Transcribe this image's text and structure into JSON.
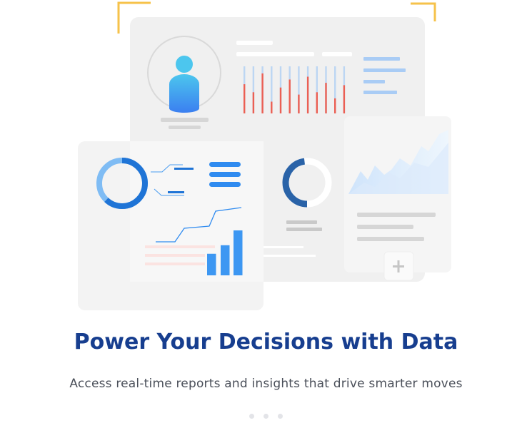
{
  "onboarding": {
    "title": "Power Your Decisions with Data",
    "subtitle": "Access real-time reports and insights that drive smarter moves",
    "pagination": {
      "total_pages": 3
    }
  },
  "illustration": {
    "icons": [
      "user-avatar-icon",
      "donut-chart-icon",
      "bar-chart-icon",
      "line-chart-icon",
      "area-chart-icon",
      "add-icon",
      "menu-icon"
    ],
    "colors": {
      "accent": "#2f8bf0",
      "title": "#173e8f",
      "bars_red": "#ec5f53",
      "corner_marks": "#f6c24a"
    },
    "equalizer_levels": [
      0.62,
      0.45,
      0.85,
      0.25,
      0.55,
      0.72,
      0.4,
      0.78,
      0.45,
      0.65,
      0.32,
      0.6
    ],
    "donut_blue_fraction": 0.62,
    "donut_navy_fraction": 0.48,
    "mini_bar_levels": [
      0.48,
      0.67,
      1.0
    ]
  }
}
